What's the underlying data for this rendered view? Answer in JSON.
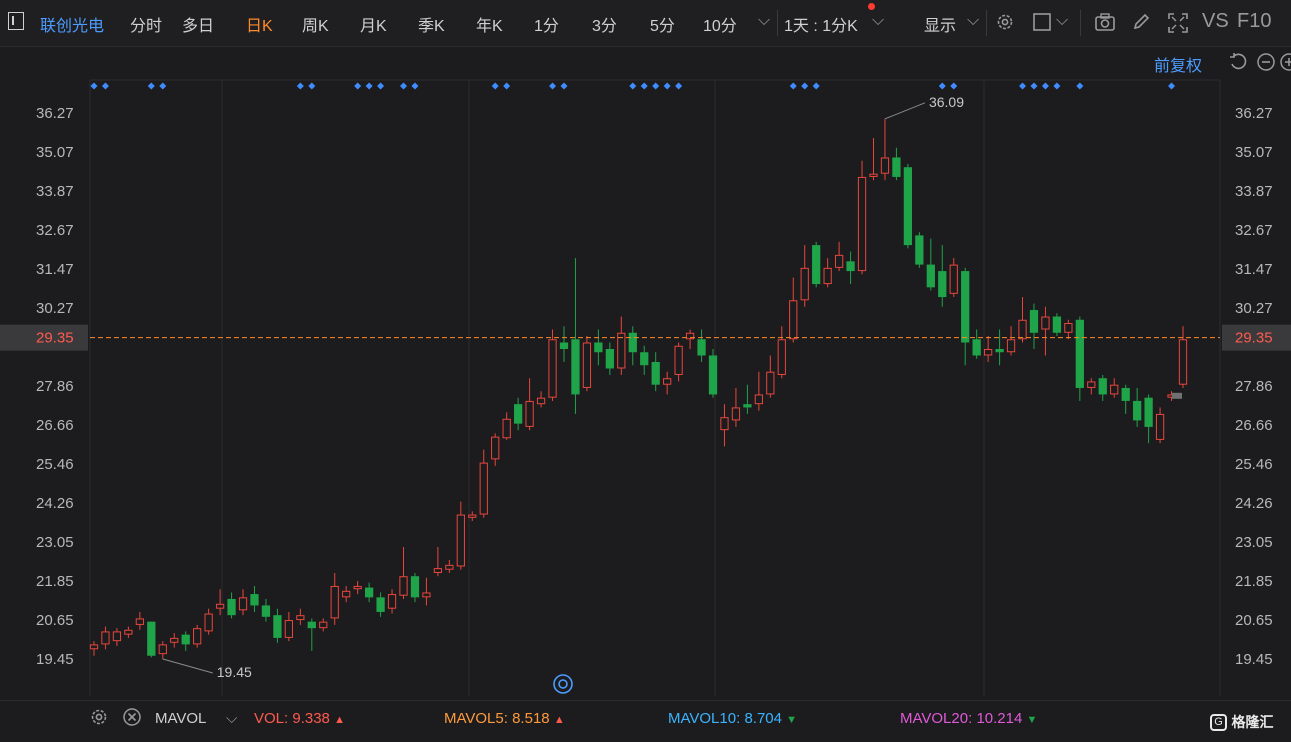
{
  "toolbar": {
    "panel_icon": "panel-icon",
    "stock_name": "联创光电",
    "periods": [
      "分时",
      "多日",
      "日K",
      "周K",
      "月K",
      "季K",
      "年K",
      "1分",
      "3分",
      "5分",
      "10分"
    ],
    "active_period": "日K",
    "period_combo": "1天 : 1分K",
    "display_label": "显示",
    "vs_label": "VS",
    "f10_label": "F10",
    "icons": [
      "gear-icon",
      "square-icon",
      "camera-icon",
      "pencil-icon",
      "fullscreen-icon"
    ]
  },
  "price_adjust": "前复权",
  "axis": {
    "labels": [
      "36.27",
      "35.07",
      "33.87",
      "32.67",
      "31.47",
      "30.27",
      "29.35",
      "27.86",
      "26.66",
      "25.46",
      "24.26",
      "23.05",
      "21.85",
      "20.65",
      "19.45"
    ],
    "current_price": "29.35"
  },
  "annotations": {
    "high": "36.09",
    "low": "19.45"
  },
  "colors": {
    "up": "#e8463c",
    "down": "#1fa44a",
    "accent": "#ff8a2a",
    "brand": "#4d9cff",
    "marker": "#3f8cff"
  },
  "indicator": {
    "name": "MAVOL",
    "vol_label": "VOL:",
    "vol_value": "9.338",
    "mavol5_label": "MAVOL5:",
    "mavol5_value": "8.518",
    "mavol10_label": "MAVOL10:",
    "mavol10_value": "8.704",
    "mavol20_label": "MAVOL20:",
    "mavol20_value": "10.214",
    "colors": {
      "vol": "#ff5a4e",
      "mavol5": "#ff9a3c",
      "mavol10": "#3bb4ff",
      "mavol20": "#e05ad8"
    }
  },
  "brand_logo": "格隆汇",
  "chart_data": {
    "type": "candlestick",
    "y_range": [
      18.9,
      36.9
    ],
    "candles": [
      [
        19.75,
        19.9,
        19.55,
        20.0
      ],
      [
        19.9,
        20.3,
        19.75,
        20.45
      ],
      [
        20.0,
        20.3,
        19.85,
        20.4
      ],
      [
        20.2,
        20.35,
        20.1,
        20.45
      ],
      [
        20.5,
        20.7,
        20.35,
        20.9
      ],
      [
        20.6,
        19.55,
        19.5,
        20.6
      ],
      [
        19.6,
        19.9,
        19.45,
        20.0
      ],
      [
        19.95,
        20.1,
        19.8,
        20.25
      ],
      [
        20.2,
        19.9,
        19.7,
        20.3
      ],
      [
        19.9,
        20.4,
        19.8,
        20.5
      ],
      [
        20.3,
        20.85,
        20.2,
        21.0
      ],
      [
        21.0,
        21.15,
        20.8,
        21.6
      ],
      [
        21.3,
        20.8,
        20.7,
        21.5
      ],
      [
        20.95,
        21.35,
        20.8,
        21.6
      ],
      [
        21.45,
        21.1,
        20.9,
        21.7
      ],
      [
        21.1,
        20.75,
        20.6,
        21.3
      ],
      [
        20.8,
        20.1,
        19.95,
        21.0
      ],
      [
        20.1,
        20.65,
        20.0,
        20.9
      ],
      [
        20.65,
        20.8,
        20.5,
        21.0
      ],
      [
        20.6,
        20.4,
        19.7,
        20.7
      ],
      [
        20.4,
        20.6,
        20.3,
        20.7
      ],
      [
        20.7,
        21.7,
        20.5,
        22.1
      ],
      [
        21.35,
        21.55,
        21.2,
        21.7
      ],
      [
        21.6,
        21.7,
        21.45,
        21.85
      ],
      [
        21.65,
        21.35,
        21.2,
        21.8
      ],
      [
        21.35,
        20.9,
        20.75,
        21.5
      ],
      [
        21.0,
        21.45,
        20.85,
        21.6
      ],
      [
        21.4,
        22.0,
        21.3,
        22.9
      ],
      [
        22.0,
        21.35,
        21.2,
        22.1
      ],
      [
        21.35,
        21.5,
        21.1,
        21.95
      ],
      [
        22.1,
        22.25,
        22.0,
        22.9
      ],
      [
        22.2,
        22.35,
        22.1,
        22.5
      ],
      [
        22.3,
        23.9,
        22.2,
        24.3
      ],
      [
        23.8,
        23.9,
        23.7,
        24.0
      ],
      [
        23.9,
        25.5,
        23.8,
        25.9
      ],
      [
        25.6,
        26.3,
        25.4,
        26.4
      ],
      [
        26.25,
        26.85,
        26.2,
        27.05
      ],
      [
        27.3,
        26.7,
        26.5,
        27.5
      ],
      [
        26.6,
        27.4,
        26.5,
        28.1
      ],
      [
        27.3,
        27.5,
        27.2,
        27.7
      ],
      [
        27.5,
        29.3,
        27.4,
        29.6
      ],
      [
        29.2,
        29.0,
        28.6,
        29.7
      ],
      [
        29.3,
        27.6,
        27.0,
        31.8
      ],
      [
        27.8,
        29.2,
        27.7,
        29.4
      ],
      [
        29.2,
        28.9,
        28.5,
        29.6
      ],
      [
        29.0,
        28.4,
        28.2,
        29.2
      ],
      [
        28.4,
        29.5,
        28.2,
        30.0
      ],
      [
        29.5,
        28.9,
        28.5,
        29.7
      ],
      [
        28.9,
        28.5,
        28.2,
        29.1
      ],
      [
        28.6,
        27.9,
        27.7,
        28.9
      ],
      [
        27.9,
        28.1,
        27.6,
        28.3
      ],
      [
        28.2,
        29.1,
        28.0,
        29.2
      ],
      [
        29.3,
        29.5,
        29.0,
        29.6
      ],
      [
        29.3,
        28.8,
        28.6,
        29.6
      ],
      [
        28.8,
        27.6,
        27.5,
        29.0
      ],
      [
        26.5,
        26.9,
        26.0,
        27.3
      ],
      [
        26.8,
        27.2,
        26.6,
        27.8
      ],
      [
        27.3,
        27.2,
        27.0,
        27.9
      ],
      [
        27.3,
        27.6,
        27.1,
        28.3
      ],
      [
        27.6,
        28.3,
        27.5,
        28.8
      ],
      [
        28.2,
        29.3,
        28.1,
        29.7
      ],
      [
        29.3,
        30.5,
        29.2,
        31.2
      ],
      [
        30.5,
        31.5,
        30.3,
        32.2
      ],
      [
        32.2,
        31.0,
        30.9,
        32.3
      ],
      [
        31.0,
        31.5,
        30.9,
        31.8
      ],
      [
        31.5,
        31.9,
        31.4,
        32.3
      ],
      [
        31.7,
        31.4,
        31.0,
        32.0
      ],
      [
        31.4,
        34.3,
        31.3,
        34.8
      ],
      [
        34.3,
        34.4,
        34.2,
        35.5
      ],
      [
        34.4,
        34.9,
        34.2,
        36.09
      ],
      [
        34.9,
        34.3,
        34.2,
        35.2
      ],
      [
        34.6,
        32.2,
        32.1,
        34.7
      ],
      [
        32.5,
        31.6,
        31.5,
        32.6
      ],
      [
        31.6,
        30.9,
        30.8,
        32.4
      ],
      [
        31.4,
        30.6,
        30.3,
        32.2
      ],
      [
        30.7,
        31.6,
        30.6,
        31.8
      ],
      [
        31.4,
        29.2,
        28.5,
        31.5
      ],
      [
        29.3,
        28.8,
        28.7,
        29.6
      ],
      [
        28.8,
        29.0,
        28.6,
        29.4
      ],
      [
        29.0,
        28.9,
        28.5,
        29.6
      ],
      [
        28.9,
        29.3,
        28.8,
        29.7
      ],
      [
        29.3,
        29.9,
        29.2,
        30.6
      ],
      [
        30.2,
        29.5,
        29.0,
        30.4
      ],
      [
        29.6,
        30.0,
        28.8,
        30.3
      ],
      [
        30.0,
        29.5,
        29.4,
        30.1
      ],
      [
        29.5,
        29.8,
        29.3,
        29.9
      ],
      [
        29.9,
        27.8,
        27.4,
        30.0
      ],
      [
        27.8,
        28.0,
        27.6,
        28.1
      ],
      [
        28.1,
        27.6,
        27.4,
        28.2
      ],
      [
        27.6,
        27.9,
        27.5,
        28.1
      ],
      [
        27.8,
        27.4,
        27.0,
        27.9
      ],
      [
        27.4,
        26.8,
        26.6,
        27.8
      ],
      [
        27.5,
        26.6,
        26.1,
        27.6
      ],
      [
        26.2,
        27.0,
        26.1,
        27.2
      ],
      [
        27.5,
        27.6,
        27.4,
        27.7
      ],
      [
        27.9,
        29.3,
        27.8,
        29.7
      ]
    ],
    "event_marker_rows": [
      [
        0,
        1,
        5,
        6,
        18,
        19,
        23,
        24,
        25,
        27,
        28,
        35,
        36,
        40,
        41,
        47,
        48,
        49,
        50,
        51,
        61,
        62,
        63,
        74,
        75,
        81,
        82,
        83,
        84,
        86,
        94
      ]
    ]
  }
}
